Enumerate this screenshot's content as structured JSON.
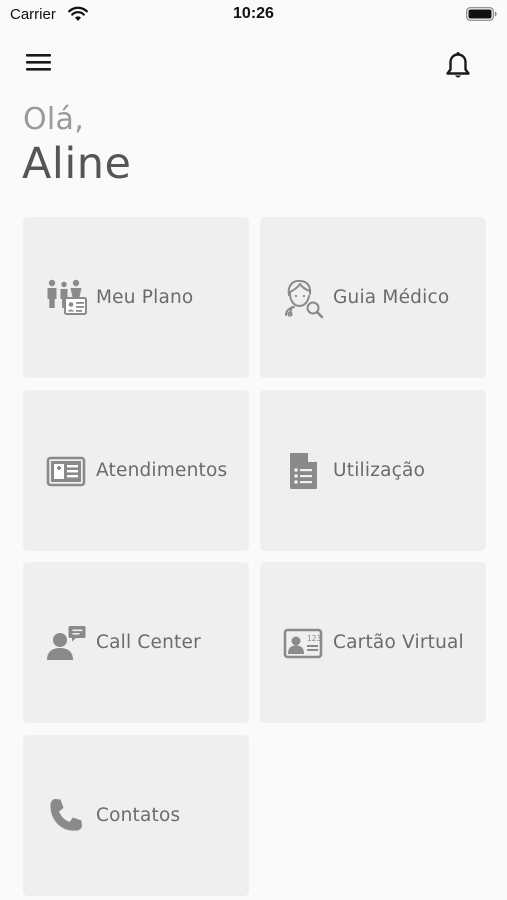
{
  "status_bar": {
    "carrier": "Carrier",
    "time": "10:26"
  },
  "header": {
    "greeting": "Olá,",
    "user_name": "Aline"
  },
  "tiles": [
    {
      "label": "Meu Plano",
      "icon": "family-card-icon"
    },
    {
      "label": "Guia Médico",
      "icon": "doctor-search-icon"
    },
    {
      "label": "Atendimentos",
      "icon": "id-card-icon"
    },
    {
      "label": "Utilização",
      "icon": "document-list-icon"
    },
    {
      "label": "Call Center",
      "icon": "person-chat-icon"
    },
    {
      "label": "Cartão Virtual",
      "icon": "virtual-card-icon"
    },
    {
      "label": "Contatos",
      "icon": "phone-icon"
    }
  ],
  "colors": {
    "background": "#fafafa",
    "tile": "#efefef",
    "text": "#6b6b6b",
    "icon": "#8a8a8a"
  }
}
